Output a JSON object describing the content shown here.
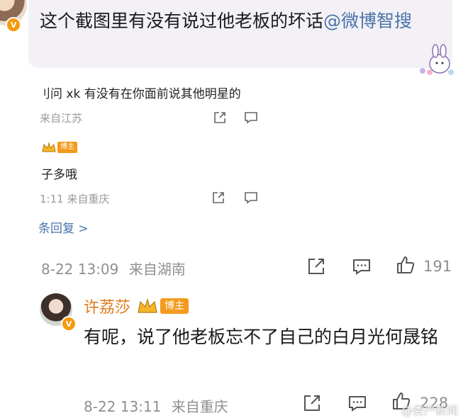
{
  "top_comment": {
    "text": "这个截图里有没有说过他老板的坏话",
    "mention": "@微博智搜"
  },
  "screenshot": {
    "reply1_text": "刂问 xk 有没有在你面前说其他明星的",
    "reply1_meta": "来自江苏",
    "reply2_text": "子多哦",
    "reply2_meta": "1:11  来自重庆",
    "badge_label": "博主",
    "more_replies": "条回复 >"
  },
  "comment_meta": {
    "time": "8-22 13:09",
    "location": "来自湖南",
    "likes": "191"
  },
  "reply": {
    "user_name": "许荔莎",
    "badge_label": "博主",
    "text": "有呢，说了他老板忘不了自己的白月光何晟铭",
    "time": "8-22 13:11",
    "location": "来自重庆",
    "likes": "228"
  },
  "watermark": "@娄严新闻",
  "icons": {
    "share": "share-icon",
    "comment": "comment-icon",
    "like": "thumbs-up-icon",
    "verified": "verified-v-icon",
    "crown": "crown-icon"
  },
  "colors": {
    "mention": "#4a74a8",
    "username": "#e07a1c",
    "badge": "#f39a1d",
    "meta_gray": "#8f8f8f"
  }
}
